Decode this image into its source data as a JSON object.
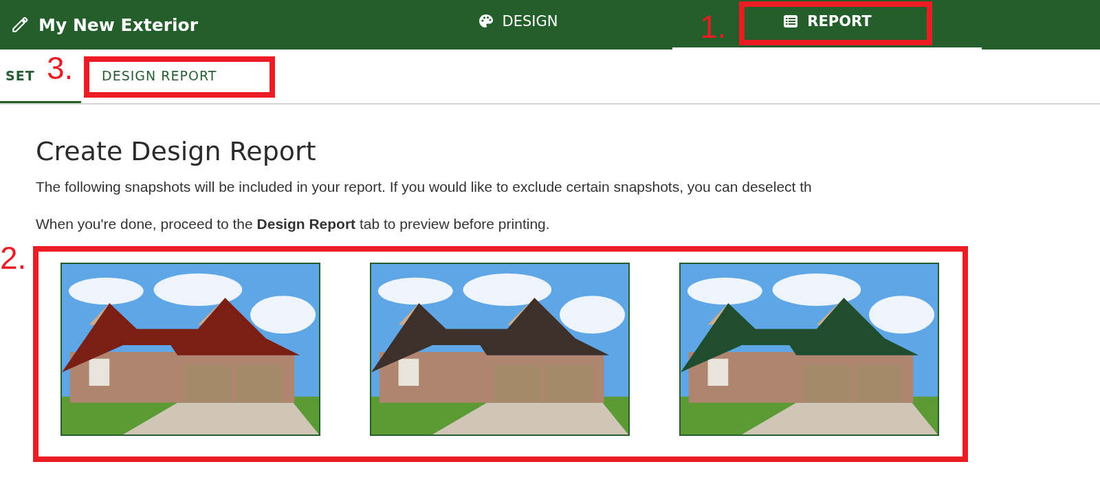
{
  "header": {
    "title": "My New Exterior",
    "tabs": [
      {
        "label": "DESIGN",
        "kind": "palette",
        "selected": false
      },
      {
        "label": "REPORT",
        "kind": "list",
        "selected": true
      }
    ]
  },
  "subtabs": [
    {
      "label": "SET",
      "selected": true
    },
    {
      "label": "DESIGN REPORT",
      "selected": false
    }
  ],
  "heading": "Create Design Report",
  "paragraphs": [
    "The following snapshots will be included in your report. If you would like to exclude certain snapshots, you can deselect th",
    "When you're done, proceed to the **Design Report** tab to preview before printing."
  ],
  "snapshots": [
    {
      "color": "#7b1f14"
    },
    {
      "color": "#3d302a"
    },
    {
      "color": "#1f4d2e"
    }
  ],
  "annotations": [
    {
      "label": "1."
    },
    {
      "label": "2."
    },
    {
      "label": "3."
    }
  ]
}
